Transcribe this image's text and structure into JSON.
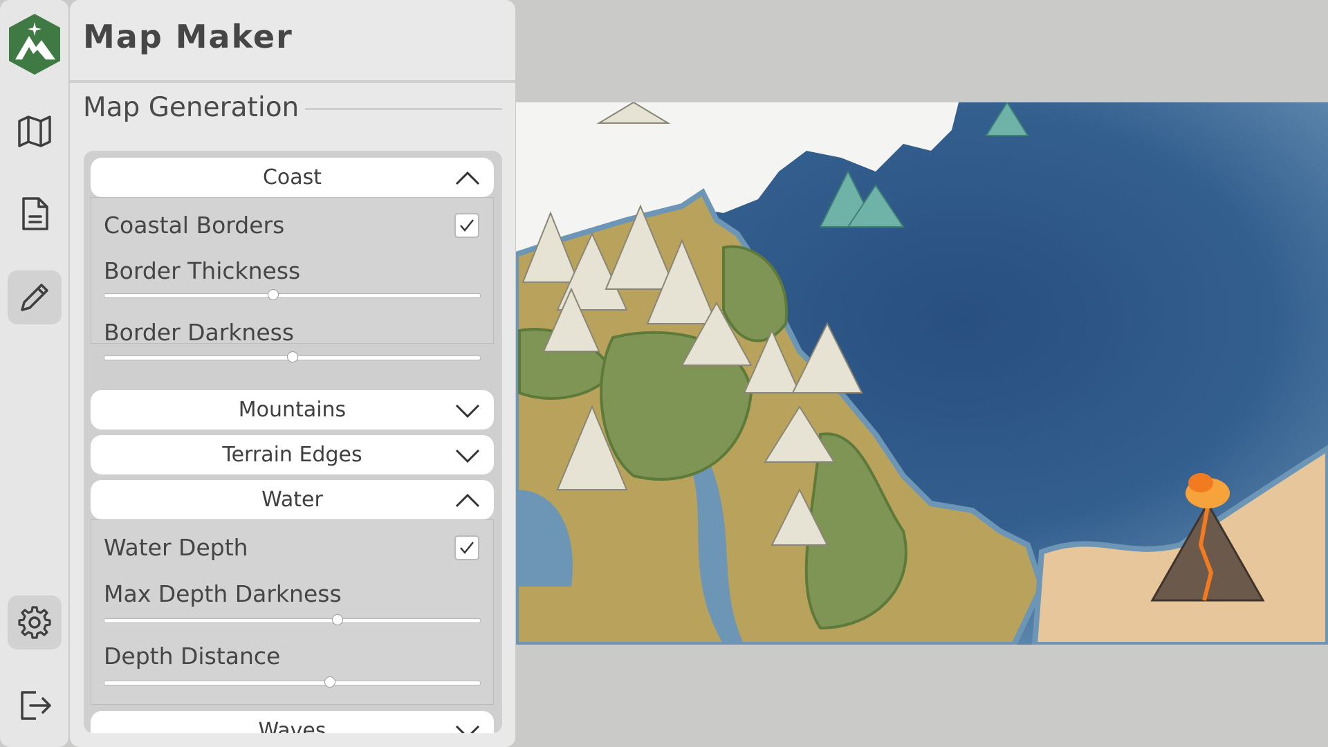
{
  "app": {
    "title": "Map Maker"
  },
  "rail": {
    "items": [
      {
        "name": "logo",
        "icon": "mountain-star-logo"
      },
      {
        "name": "maps",
        "icon": "map-icon"
      },
      {
        "name": "document",
        "icon": "document-icon"
      },
      {
        "name": "edit",
        "icon": "pencil-icon",
        "active": true
      },
      {
        "name": "settings",
        "icon": "gear-icon"
      },
      {
        "name": "exit",
        "icon": "logout-icon"
      }
    ]
  },
  "section": {
    "title": "Map Generation"
  },
  "accordions": {
    "coast": {
      "label": "Coast",
      "expanded": true,
      "coastal_borders": {
        "label": "Coastal Borders",
        "checked": true
      },
      "border_thickness": {
        "label": "Border Thickness",
        "value": 0.45
      },
      "border_darkness": {
        "label": "Border Darkness",
        "value": 0.5
      }
    },
    "mountains": {
      "label": "Mountains",
      "expanded": false
    },
    "terrain_edges": {
      "label": "Terrain Edges",
      "expanded": false
    },
    "water": {
      "label": "Water",
      "expanded": true,
      "water_depth": {
        "label": "Water Depth",
        "checked": true
      },
      "max_depth_darkness": {
        "label": "Max Depth Darkness",
        "value": 0.62
      },
      "depth_distance": {
        "label": "Depth Distance",
        "value": 0.6
      }
    },
    "waves": {
      "label": "Waves",
      "expanded": false
    }
  },
  "colors": {
    "deep_water": "#284f7f",
    "shallow_water": "#6d95b6",
    "land": "#b9a35c",
    "forest": "#7f9555",
    "snow": "#f4f4f2",
    "desert": "#e6c69a",
    "lava": "#f27a20"
  }
}
